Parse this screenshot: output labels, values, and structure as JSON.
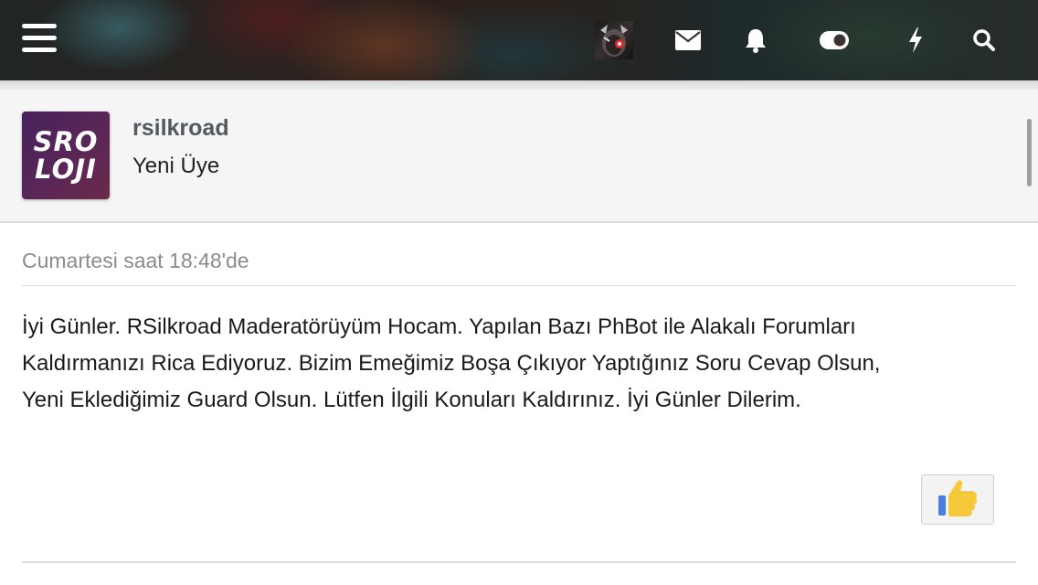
{
  "nav": {
    "menu_icon": "hamburger-menu-icon",
    "icons": [
      "user-avatar",
      "envelope-icon",
      "bell-icon",
      "toggle-icon",
      "bolt-icon",
      "search-icon"
    ]
  },
  "user": {
    "avatar_line1": "SRO",
    "avatar_line2": "LOJI",
    "name": "rsilkroad",
    "title": "Yeni Üye"
  },
  "post": {
    "date": "Cumartesi saat 18:48'de",
    "body_line1": "İyi Günler. RSilkroad Maderatörüyüm Hocam. Yapılan Bazı PhBot ile Alakalı Forumları",
    "body_line2": "Kaldırmanızı Rica Ediyoruz. Bizim Emeğimiz Boşa Çıkıyor Yaptığınız Soru Cevap Olsun,",
    "body_line3": "Yeni Eklediğimiz Guard Olsun. Lütfen İlgili Konuları Kaldırınız. İyi Günler Dilerim."
  },
  "like": {
    "icon": "thumbs-up-icon"
  },
  "colors": {
    "avatar_bg": "#4f2459",
    "username": "#52595f",
    "date": "#8c8c8c",
    "thumb": "#f5c93a",
    "thumb_cuff": "#4a7de0"
  }
}
